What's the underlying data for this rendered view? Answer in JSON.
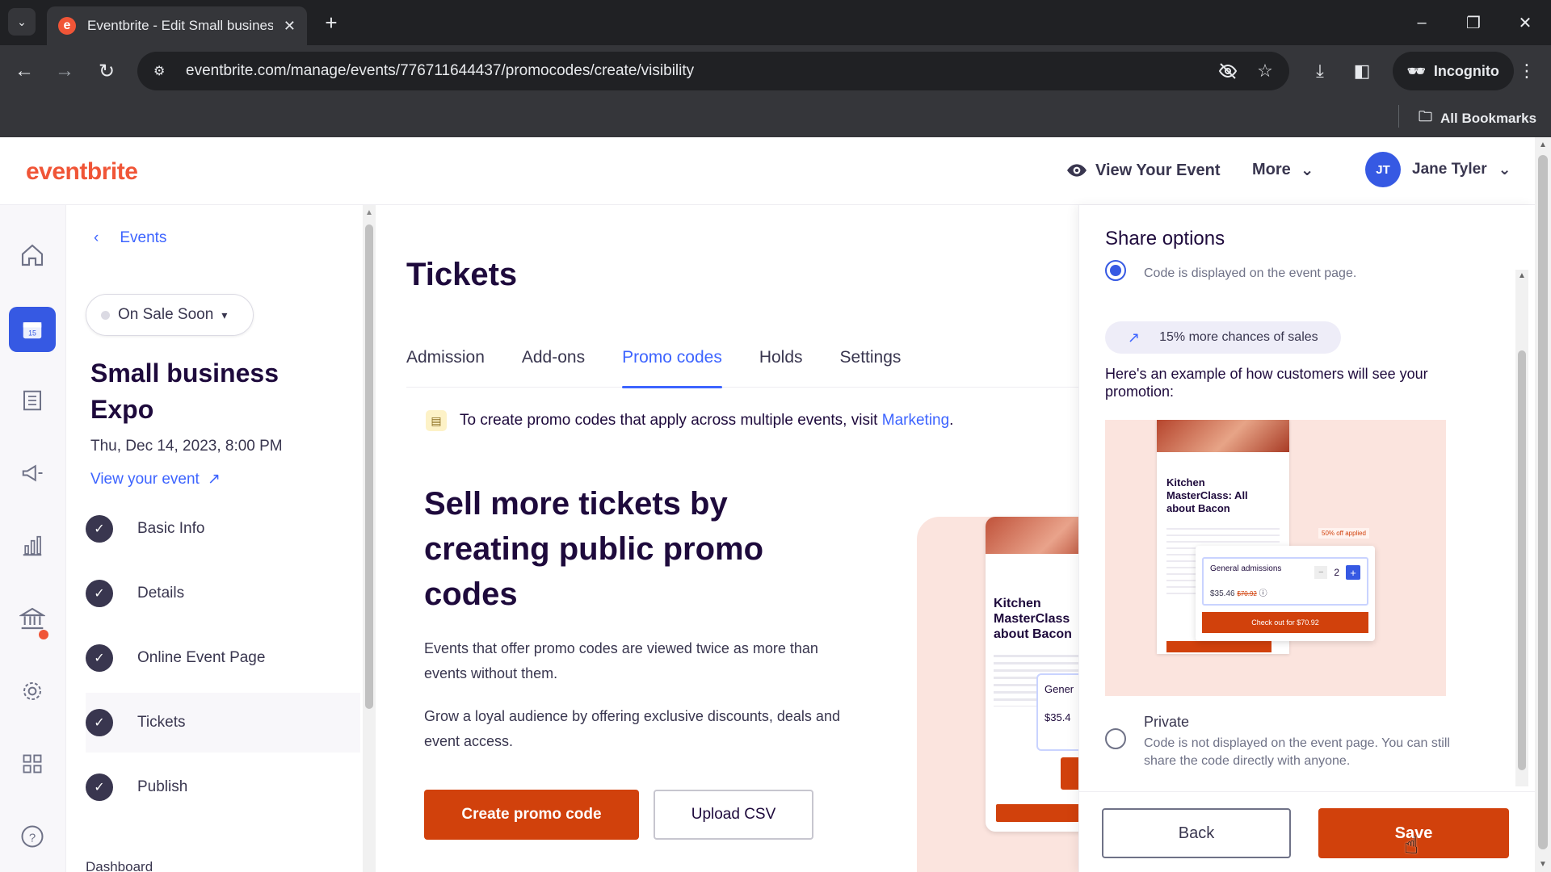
{
  "browser": {
    "tab_title": "Eventbrite - Edit Small busines",
    "favicon_letter": "e",
    "url": "eventbrite.com/manage/events/776711644437/promocodes/create/visibility",
    "incognito_label": "Incognito",
    "all_bookmarks": "All Bookmarks"
  },
  "header": {
    "logo": "eventbrite",
    "view_event": "View Your Event",
    "more": "More",
    "user_initials": "JT",
    "user_name": "Jane Tyler"
  },
  "sidebar": {
    "back_label": "Events",
    "status": "On Sale Soon",
    "event_name": "Small business Expo",
    "event_date": "Thu, Dec 14, 2023, 8:00 PM",
    "view_your_event": "View your event",
    "steps": [
      {
        "label": "Basic Info"
      },
      {
        "label": "Details"
      },
      {
        "label": "Online Event Page"
      },
      {
        "label": "Tickets"
      },
      {
        "label": "Publish"
      }
    ],
    "dashboard_partial": "Dashboard"
  },
  "main": {
    "title": "Tickets",
    "tabs": [
      {
        "label": "Admission"
      },
      {
        "label": "Add-ons"
      },
      {
        "label": "Promo codes"
      },
      {
        "label": "Holds"
      },
      {
        "label": "Settings"
      }
    ],
    "active_tab": "Promo codes",
    "notice_text": "To create promo codes that apply across multiple events, visit",
    "notice_link": "Marketing",
    "hero_title": "Sell more tickets by creating public promo codes",
    "hero_p1": "Events that offer promo codes are viewed twice as more than events without them.",
    "hero_p2": "Grow a loyal audience by offering exclusive discounts, deals and event access.",
    "create_button": "Create promo code",
    "upload_button": "Upload CSV",
    "illustration_title": "Kitchen MasterClass about Bacon",
    "illustration_card": "Gener",
    "illustration_price": "$35.4"
  },
  "drawer": {
    "title": "Share options",
    "public_desc": "Code is displayed on the event page.",
    "boost": "15% more chances of sales",
    "example_text": "Here's an example of how customers will see your promotion:",
    "preview": {
      "event_title": "Kitchen MasterClass: All about Bacon",
      "badge": "50% off applied",
      "ticket_type": "General admissions",
      "quantity": "2",
      "price": "$35.46",
      "old_price": "$70.92",
      "checkout": "Check out for $70.92"
    },
    "private_label": "Private",
    "private_desc": "Code is not displayed on the event page. You can still share the code directly with anyone.",
    "back_button": "Back",
    "save_button": "Save",
    "selected_option": "Public"
  },
  "colors": {
    "brand": "#f05537",
    "primary_button": "#d1410c",
    "link": "#3d64ff",
    "accent_blue": "#3659e3",
    "heading": "#1e0a3c"
  }
}
